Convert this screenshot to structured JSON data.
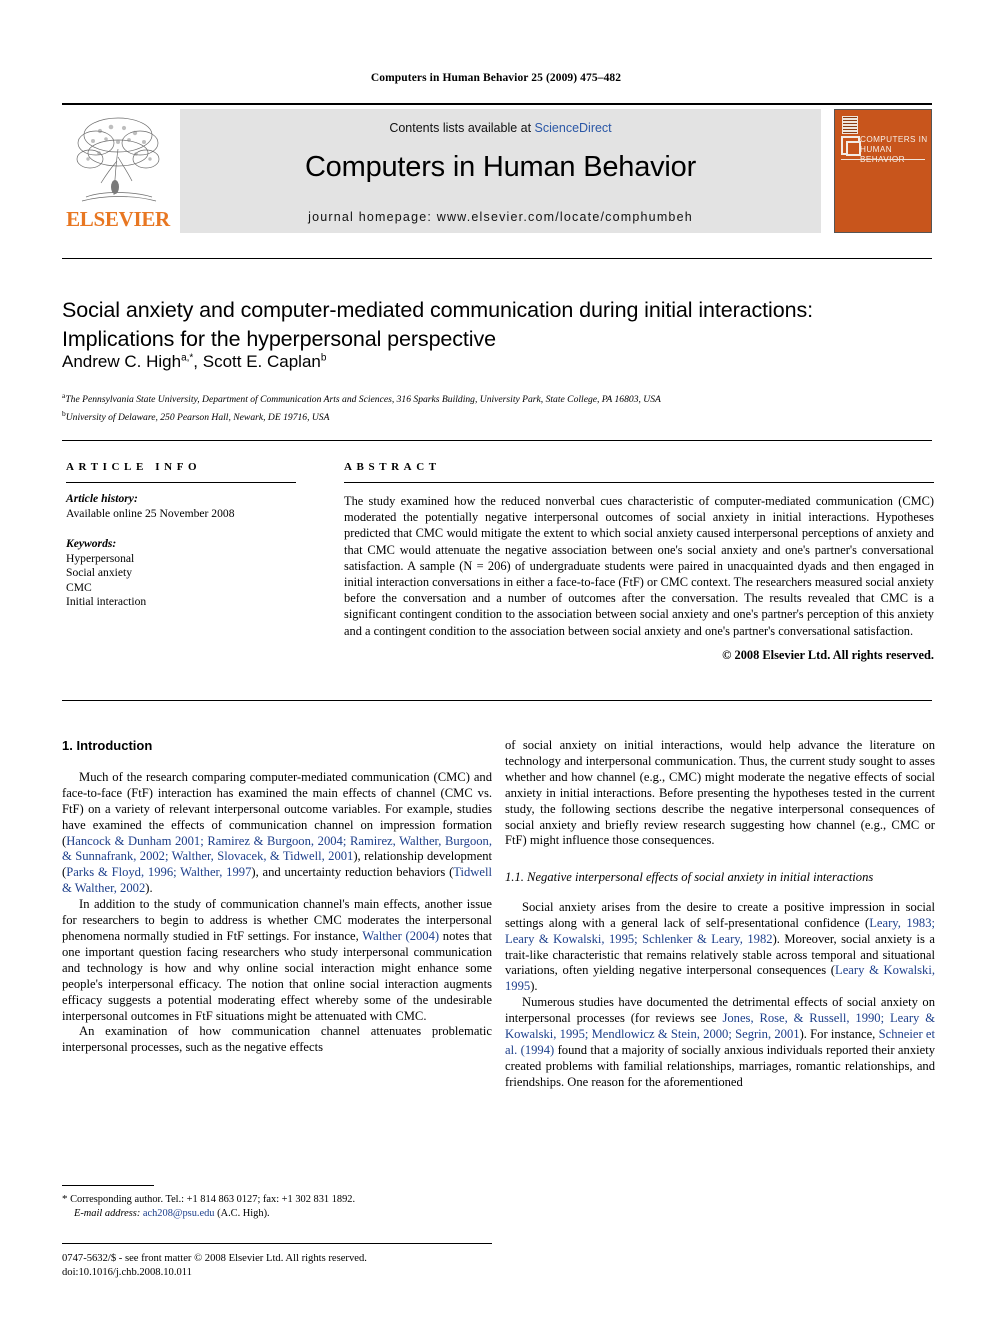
{
  "running_head": "Computers in Human Behavior 25 (2009) 475–482",
  "masthead": {
    "publisher_name": "ELSEVIER",
    "contents_prefix": "Contents lists available at ",
    "contents_link": "ScienceDirect",
    "journal_title": "Computers in Human Behavior",
    "homepage": "journal homepage: www.elsevier.com/locate/comphumbeh",
    "cover_title": "COMPUTERS IN HUMAN BEHAVIOR"
  },
  "article": {
    "title": "Social anxiety and computer-mediated communication during initial interactions: Implications for the hyperpersonal perspective",
    "authors": "Andrew C. High",
    "author_1_sup": "a,*",
    "authors_2": ", Scott E. Caplan",
    "author_2_sup": "b",
    "affiliation_a_sup": "a",
    "affiliation_a": "The Pennsylvania State University, Department of Communication Arts and Sciences, 316 Sparks Building, University Park, State College, PA 16803, USA",
    "affiliation_b_sup": "b",
    "affiliation_b": "University of Delaware, 250 Pearson Hall, Newark, DE 19716, USA"
  },
  "article_info": {
    "heading": "ARTICLE INFO",
    "history_label": "Article history:",
    "history_value": "Available online 25 November 2008",
    "keywords_label": "Keywords:",
    "keywords": [
      "Hyperpersonal",
      "Social anxiety",
      "CMC",
      "Initial interaction"
    ]
  },
  "abstract": {
    "heading": "ABSTRACT",
    "text": "The study examined how the reduced nonverbal cues characteristic of computer-mediated communication (CMC) moderated the potentially negative interpersonal outcomes of social anxiety in initial interactions. Hypotheses predicted that CMC would mitigate the extent to which social anxiety caused interpersonal perceptions of anxiety and that CMC would attenuate the negative association between one's social anxiety and one's partner's conversational satisfaction. A sample (N = 206) of undergraduate students were paired in unacquainted dyads and then engaged in initial interaction conversations in either a face-to-face (FtF) or CMC context. The researchers measured social anxiety before the conversation and a number of outcomes after the conversation. The results revealed that CMC is a significant contingent condition to the association between social anxiety and one's partner's perception of this anxiety and a contingent condition to the association between social anxiety and one's partner's conversational satisfaction.",
    "copyright": "© 2008 Elsevier Ltd. All rights reserved."
  },
  "body": {
    "section_1_heading": "1. Introduction",
    "p1_a": "Much of the research comparing computer-mediated communication (CMC) and face-to-face (FtF) interaction has examined the main effects of channel (CMC vs. FtF) on a variety of relevant interpersonal outcome variables. For example, studies have examined the effects of communication channel on impression formation (",
    "p1_cite1": "Hancock & Dunham 2001; Ramirez & Burgoon, 2004; Ramirez, Walther, Burgoon, & Sunnafrank, 2002; Walther, Slovacek, & Tidwell, 2001",
    "p1_b": "), relationship development (",
    "p1_cite2": "Parks & Floyd, 1996; Walther, 1997",
    "p1_c": "), and uncertainty reduction behaviors (",
    "p1_cite3": "Tidwell & Walther, 2002",
    "p1_d": ").",
    "p2_a": "In addition to the study of communication channel's main effects, another issue for researchers to begin to address is whether CMC moderates the interpersonal phenomena normally studied in FtF settings. For instance, ",
    "p2_cite1": "Walther (2004)",
    "p2_b": " notes that one important question facing researchers who study interpersonal communication and technology is how and why online social interaction might enhance some people's interpersonal efficacy. The notion that online social interaction augments efficacy suggests a potential moderating effect whereby some of the undesirable interpersonal outcomes in FtF situations might be attenuated with CMC.",
    "p3": "An examination of how communication channel attenuates problematic interpersonal processes, such as the negative effects",
    "p3_cont": "of social anxiety on initial interactions, would help advance the literature on technology and interpersonal communication. Thus, the current study sought to asses whether and how channel (e.g., CMC) might moderate the negative effects of social anxiety in initial interactions. Before presenting the hypotheses tested in the current study, the following sections describe the negative interpersonal consequences of social anxiety and briefly review research suggesting how channel (e.g., CMC or FtF) might influence those consequences.",
    "section_11_heading": "1.1. Negative interpersonal effects of social anxiety in initial interactions",
    "p4_a": "Social anxiety arises from the desire to create a positive impression in social settings along with a general lack of self-presentational confidence (",
    "p4_cite1": "Leary, 1983; Leary & Kowalski, 1995; Schlenker & Leary, 1982",
    "p4_b": "). Moreover, social anxiety is a trait-like characteristic that remains relatively stable across temporal and situational variations, often yielding negative interpersonal consequences (",
    "p4_cite2": "Leary & Kowalski, 1995",
    "p4_c": ").",
    "p5_a": "Numerous studies have documented the detrimental effects of social anxiety on interpersonal processes (for reviews see ",
    "p5_cite1": "Jones, Rose, & Russell, 1990; Leary & Kowalski, 1995; Mendlowicz & Stein, 2000; Segrin, 2001",
    "p5_b": "). For instance, ",
    "p5_cite2": "Schneier et al. (1994)",
    "p5_c": " found that a majority of socially anxious individuals reported their anxiety created problems with familial relationships, marriages, romantic relationships, and friendships. One reason for the aforementioned"
  },
  "footnote": {
    "star": "*",
    "corresponding": "Corresponding author. Tel.: +1 814 863 0127; fax: +1 302 831 1892.",
    "email_label": "E-mail address:",
    "email": "ach208@psu.edu",
    "email_owner": "(A.C. High)."
  },
  "imprint": {
    "line1": "0747-5632/$ - see front matter © 2008 Elsevier Ltd. All rights reserved.",
    "line2": "doi:10.1016/j.chb.2008.10.011"
  },
  "colors": {
    "link_blue": "#2b57a6",
    "citation_blue": "#1d3f8b",
    "elsevier_orange": "#E87722",
    "cover_orange": "#C8551C",
    "band_gray": "#e3e3e3"
  }
}
